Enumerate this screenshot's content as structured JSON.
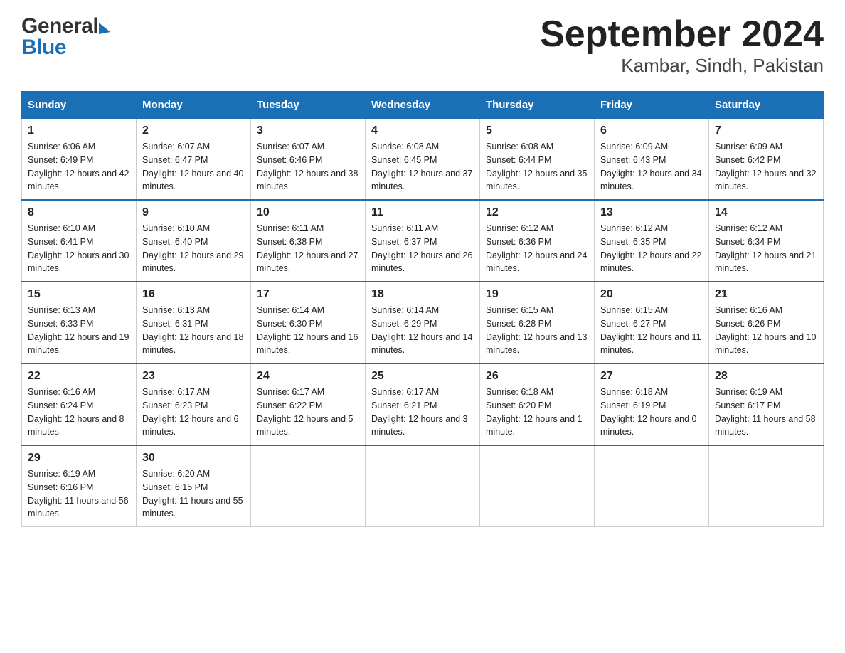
{
  "logo": {
    "general": "General",
    "blue": "Blue"
  },
  "title": "September 2024",
  "subtitle": "Kambar, Sindh, Pakistan",
  "columns": [
    "Sunday",
    "Monday",
    "Tuesday",
    "Wednesday",
    "Thursday",
    "Friday",
    "Saturday"
  ],
  "weeks": [
    [
      {
        "day": "1",
        "sunrise": "Sunrise: 6:06 AM",
        "sunset": "Sunset: 6:49 PM",
        "daylight": "Daylight: 12 hours and 42 minutes."
      },
      {
        "day": "2",
        "sunrise": "Sunrise: 6:07 AM",
        "sunset": "Sunset: 6:47 PM",
        "daylight": "Daylight: 12 hours and 40 minutes."
      },
      {
        "day": "3",
        "sunrise": "Sunrise: 6:07 AM",
        "sunset": "Sunset: 6:46 PM",
        "daylight": "Daylight: 12 hours and 38 minutes."
      },
      {
        "day": "4",
        "sunrise": "Sunrise: 6:08 AM",
        "sunset": "Sunset: 6:45 PM",
        "daylight": "Daylight: 12 hours and 37 minutes."
      },
      {
        "day": "5",
        "sunrise": "Sunrise: 6:08 AM",
        "sunset": "Sunset: 6:44 PM",
        "daylight": "Daylight: 12 hours and 35 minutes."
      },
      {
        "day": "6",
        "sunrise": "Sunrise: 6:09 AM",
        "sunset": "Sunset: 6:43 PM",
        "daylight": "Daylight: 12 hours and 34 minutes."
      },
      {
        "day": "7",
        "sunrise": "Sunrise: 6:09 AM",
        "sunset": "Sunset: 6:42 PM",
        "daylight": "Daylight: 12 hours and 32 minutes."
      }
    ],
    [
      {
        "day": "8",
        "sunrise": "Sunrise: 6:10 AM",
        "sunset": "Sunset: 6:41 PM",
        "daylight": "Daylight: 12 hours and 30 minutes."
      },
      {
        "day": "9",
        "sunrise": "Sunrise: 6:10 AM",
        "sunset": "Sunset: 6:40 PM",
        "daylight": "Daylight: 12 hours and 29 minutes."
      },
      {
        "day": "10",
        "sunrise": "Sunrise: 6:11 AM",
        "sunset": "Sunset: 6:38 PM",
        "daylight": "Daylight: 12 hours and 27 minutes."
      },
      {
        "day": "11",
        "sunrise": "Sunrise: 6:11 AM",
        "sunset": "Sunset: 6:37 PM",
        "daylight": "Daylight: 12 hours and 26 minutes."
      },
      {
        "day": "12",
        "sunrise": "Sunrise: 6:12 AM",
        "sunset": "Sunset: 6:36 PM",
        "daylight": "Daylight: 12 hours and 24 minutes."
      },
      {
        "day": "13",
        "sunrise": "Sunrise: 6:12 AM",
        "sunset": "Sunset: 6:35 PM",
        "daylight": "Daylight: 12 hours and 22 minutes."
      },
      {
        "day": "14",
        "sunrise": "Sunrise: 6:12 AM",
        "sunset": "Sunset: 6:34 PM",
        "daylight": "Daylight: 12 hours and 21 minutes."
      }
    ],
    [
      {
        "day": "15",
        "sunrise": "Sunrise: 6:13 AM",
        "sunset": "Sunset: 6:33 PM",
        "daylight": "Daylight: 12 hours and 19 minutes."
      },
      {
        "day": "16",
        "sunrise": "Sunrise: 6:13 AM",
        "sunset": "Sunset: 6:31 PM",
        "daylight": "Daylight: 12 hours and 18 minutes."
      },
      {
        "day": "17",
        "sunrise": "Sunrise: 6:14 AM",
        "sunset": "Sunset: 6:30 PM",
        "daylight": "Daylight: 12 hours and 16 minutes."
      },
      {
        "day": "18",
        "sunrise": "Sunrise: 6:14 AM",
        "sunset": "Sunset: 6:29 PM",
        "daylight": "Daylight: 12 hours and 14 minutes."
      },
      {
        "day": "19",
        "sunrise": "Sunrise: 6:15 AM",
        "sunset": "Sunset: 6:28 PM",
        "daylight": "Daylight: 12 hours and 13 minutes."
      },
      {
        "day": "20",
        "sunrise": "Sunrise: 6:15 AM",
        "sunset": "Sunset: 6:27 PM",
        "daylight": "Daylight: 12 hours and 11 minutes."
      },
      {
        "day": "21",
        "sunrise": "Sunrise: 6:16 AM",
        "sunset": "Sunset: 6:26 PM",
        "daylight": "Daylight: 12 hours and 10 minutes."
      }
    ],
    [
      {
        "day": "22",
        "sunrise": "Sunrise: 6:16 AM",
        "sunset": "Sunset: 6:24 PM",
        "daylight": "Daylight: 12 hours and 8 minutes."
      },
      {
        "day": "23",
        "sunrise": "Sunrise: 6:17 AM",
        "sunset": "Sunset: 6:23 PM",
        "daylight": "Daylight: 12 hours and 6 minutes."
      },
      {
        "day": "24",
        "sunrise": "Sunrise: 6:17 AM",
        "sunset": "Sunset: 6:22 PM",
        "daylight": "Daylight: 12 hours and 5 minutes."
      },
      {
        "day": "25",
        "sunrise": "Sunrise: 6:17 AM",
        "sunset": "Sunset: 6:21 PM",
        "daylight": "Daylight: 12 hours and 3 minutes."
      },
      {
        "day": "26",
        "sunrise": "Sunrise: 6:18 AM",
        "sunset": "Sunset: 6:20 PM",
        "daylight": "Daylight: 12 hours and 1 minute."
      },
      {
        "day": "27",
        "sunrise": "Sunrise: 6:18 AM",
        "sunset": "Sunset: 6:19 PM",
        "daylight": "Daylight: 12 hours and 0 minutes."
      },
      {
        "day": "28",
        "sunrise": "Sunrise: 6:19 AM",
        "sunset": "Sunset: 6:17 PM",
        "daylight": "Daylight: 11 hours and 58 minutes."
      }
    ],
    [
      {
        "day": "29",
        "sunrise": "Sunrise: 6:19 AM",
        "sunset": "Sunset: 6:16 PM",
        "daylight": "Daylight: 11 hours and 56 minutes."
      },
      {
        "day": "30",
        "sunrise": "Sunrise: 6:20 AM",
        "sunset": "Sunset: 6:15 PM",
        "daylight": "Daylight: 11 hours and 55 minutes."
      },
      {
        "day": "",
        "sunrise": "",
        "sunset": "",
        "daylight": ""
      },
      {
        "day": "",
        "sunrise": "",
        "sunset": "",
        "daylight": ""
      },
      {
        "day": "",
        "sunrise": "",
        "sunset": "",
        "daylight": ""
      },
      {
        "day": "",
        "sunrise": "",
        "sunset": "",
        "daylight": ""
      },
      {
        "day": "",
        "sunrise": "",
        "sunset": "",
        "daylight": ""
      }
    ]
  ]
}
